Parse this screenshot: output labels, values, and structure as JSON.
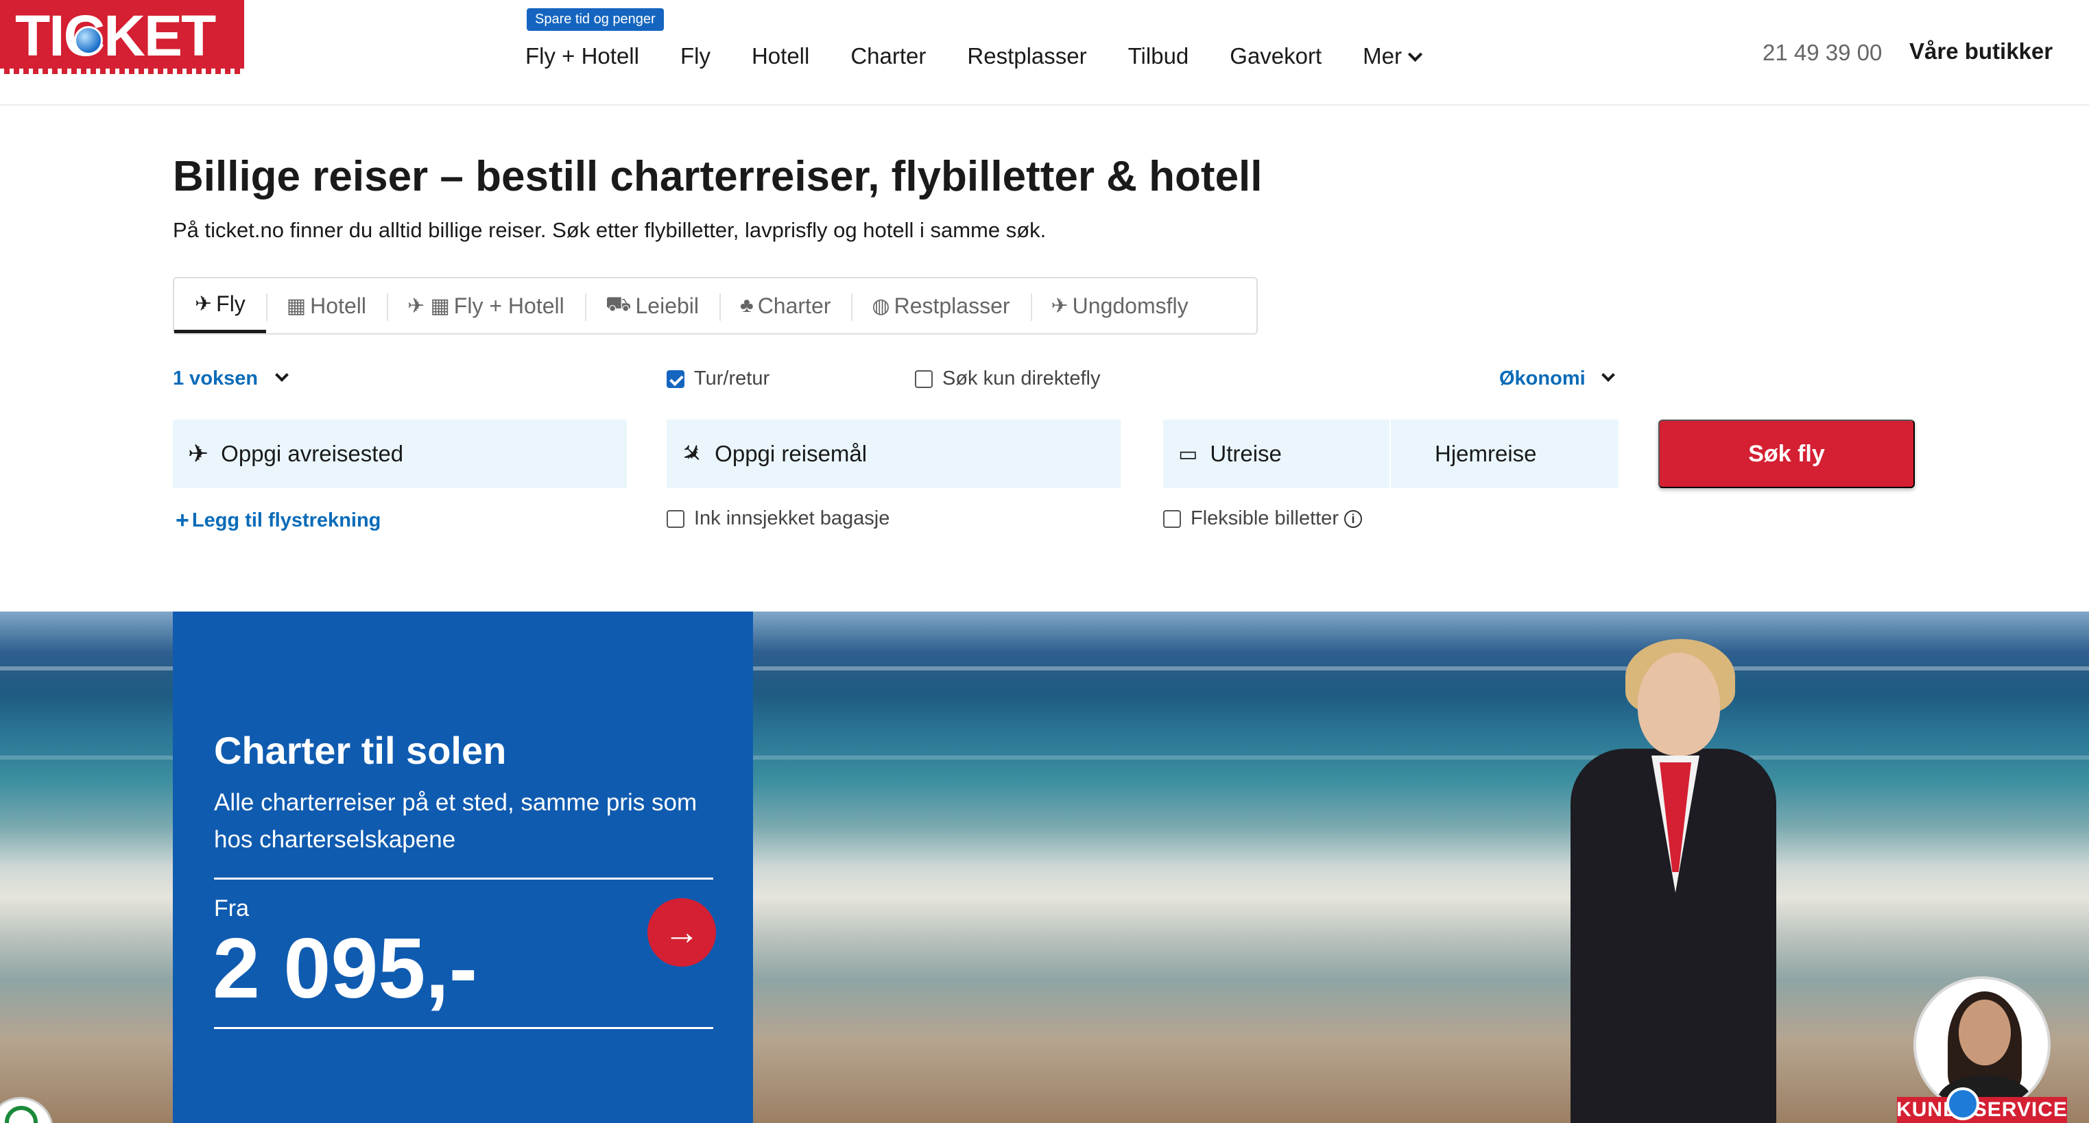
{
  "header": {
    "logo": "TICKET",
    "promo_badge": "Spare tid og penger",
    "nav": [
      "Fly + Hotell",
      "Fly",
      "Hotell",
      "Charter",
      "Restplasser",
      "Tilbud",
      "Gavekort",
      "Mer"
    ],
    "phone": "21 49 39 00",
    "stores": "Våre butikker"
  },
  "main": {
    "title": "Billige reiser – bestill charterreiser, flybilletter & hotell",
    "subtitle": "På ticket.no finner du alltid billige reiser. Søk etter flybilletter, lavprisfly og hotell i samme søk."
  },
  "tabs": [
    {
      "label": "Fly",
      "icon": "plane-icon",
      "glyph": "✈"
    },
    {
      "label": "Hotell",
      "icon": "hotel-icon",
      "glyph": "▦"
    },
    {
      "label": "Fly + Hotell",
      "icon": "plane-hotel-icon",
      "glyph": "✈ ▦"
    },
    {
      "label": "Leiebil",
      "icon": "car-icon",
      "glyph": "⛟"
    },
    {
      "label": "Charter",
      "icon": "palm-icon",
      "glyph": "♣"
    },
    {
      "label": "Restplasser",
      "icon": "fire-icon",
      "glyph": "◍"
    },
    {
      "label": "Ungdomsfly",
      "icon": "plane-icon",
      "glyph": "✈"
    }
  ],
  "search": {
    "passengers": "1 voksen",
    "round_trip": "Tur/retur",
    "direct_only": "Søk kun direktefly",
    "cabin_class": "Økonomi",
    "origin_placeholder": "Oppgi avreisested",
    "destination_placeholder": "Oppgi reisemål",
    "departure_placeholder": "Utreise",
    "return_placeholder": "Hjemreise",
    "search_button": "Søk fly",
    "add_leg": "Legg til flystrekning",
    "checked_bag": "Ink innsjekket bagasje",
    "flexible": "Fleksible billetter",
    "round_trip_checked": true,
    "direct_only_checked": false,
    "checked_bag_checked": false,
    "flexible_checked": false
  },
  "promo": {
    "title": "Charter til solen",
    "text": "Alle charterreiser på et sted, samme pris som hos charterselskapene",
    "from": "Fra",
    "price": "2 095,-"
  },
  "chat": {
    "label": "KUNDESERVICE"
  },
  "colors": {
    "brand_red": "#d42032",
    "link_blue": "#0a6bb8",
    "promo_blue": "#0f5bb0",
    "input_bg": "#eaf6fc"
  }
}
